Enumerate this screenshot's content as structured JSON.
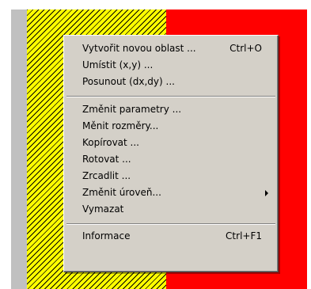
{
  "colors": {
    "menu_bg": "#d4d0c8",
    "canvas_red": "#ff0000",
    "hatch_yellow": "#ffff00",
    "hatch_line": "#000000",
    "side_gray": "#c0c0c0"
  },
  "menu": {
    "groups": [
      [
        {
          "label": "Vytvořit novou oblast ...",
          "shortcut": "Ctrl+O"
        },
        {
          "label": "Umístit (x,y) ..."
        },
        {
          "label": "Posunout (dx,dy) ..."
        }
      ],
      [
        {
          "label": "Změnit parametry ..."
        },
        {
          "label": "Měnit rozměry..."
        },
        {
          "label": "Kopírovat ..."
        },
        {
          "label": "Rotovat ..."
        },
        {
          "label": "Zrcadlit ..."
        },
        {
          "label": "Změnit úroveň...",
          "submenu": true,
          "arrow_icon": "submenu-arrow-icon"
        },
        {
          "label": "Vymazat"
        }
      ],
      [
        {
          "label": "Informace",
          "shortcut": "Ctrl+F1"
        }
      ]
    ]
  }
}
